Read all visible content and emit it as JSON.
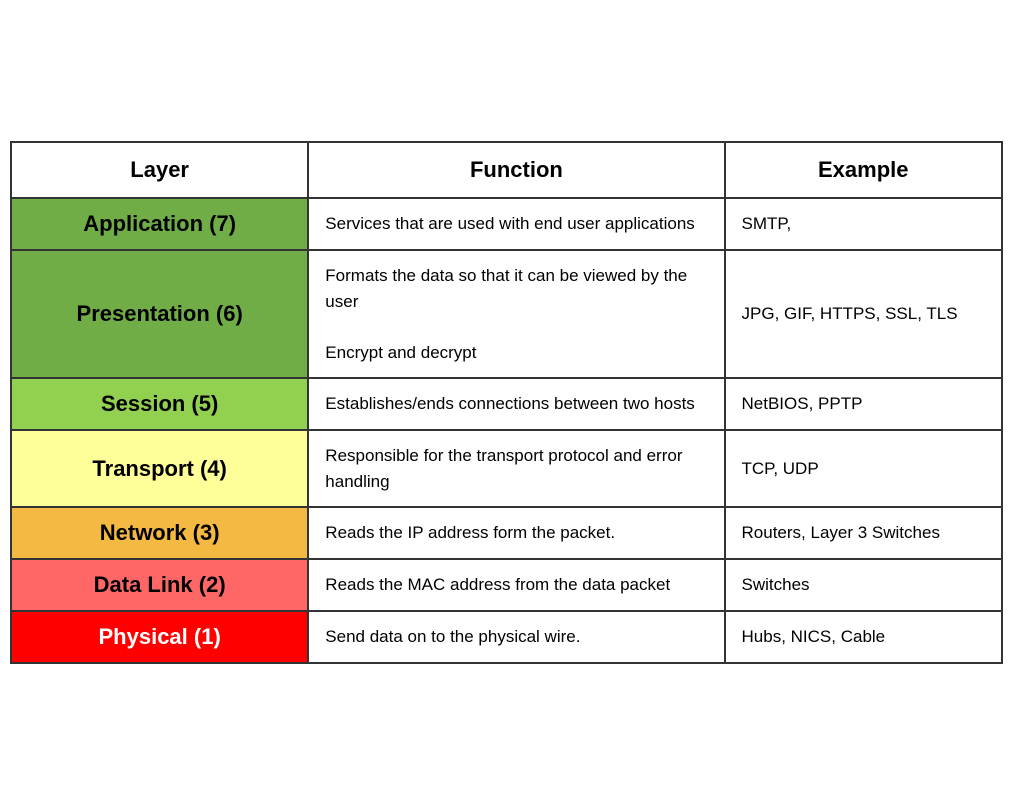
{
  "table": {
    "headers": {
      "layer": "Layer",
      "function": "Function",
      "example": "Example"
    },
    "rows": [
      {
        "id": "application",
        "layer_label": "Application (7)",
        "function_text": "Services that are used with end user applications",
        "example_text": "SMTP,",
        "bg_color": "#70ad47",
        "text_color": "#000000"
      },
      {
        "id": "presentation",
        "layer_label": "Presentation (6)",
        "function_text": "Formats the data so that it can be viewed by the user\n\nEncrypt and decrypt",
        "example_text": "JPG, GIF, HTTPS, SSL, TLS",
        "bg_color": "#70ad47",
        "text_color": "#000000"
      },
      {
        "id": "session",
        "layer_label": "Session (5)",
        "function_text": "Establishes/ends connections between two hosts",
        "example_text": "NetBIOS, PPTP",
        "bg_color": "#92d050",
        "text_color": "#000000"
      },
      {
        "id": "transport",
        "layer_label": "Transport (4)",
        "function_text": "Responsible for the transport protocol and error handling",
        "example_text": "TCP, UDP",
        "bg_color": "#ffff99",
        "text_color": "#000000"
      },
      {
        "id": "network",
        "layer_label": "Network (3)",
        "function_text": "Reads the IP address form the packet.",
        "example_text": "Routers, Layer 3 Switches",
        "bg_color": "#f4b942",
        "text_color": "#000000"
      },
      {
        "id": "datalink",
        "layer_label": "Data Link (2)",
        "function_text": "Reads the MAC address from the data packet",
        "example_text": "Switches",
        "bg_color": "#ff6666",
        "text_color": "#000000"
      },
      {
        "id": "physical",
        "layer_label": "Physical (1)",
        "function_text": "Send data on to the physical wire.",
        "example_text": "Hubs, NICS, Cable",
        "bg_color": "#ff0000",
        "text_color": "#ffffff"
      }
    ]
  }
}
